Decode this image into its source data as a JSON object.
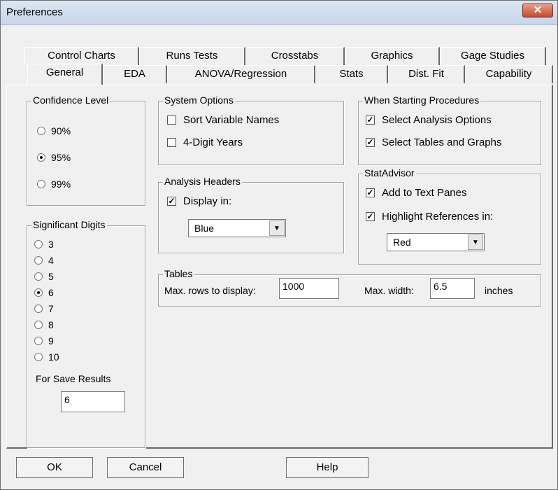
{
  "window": {
    "title": "Preferences"
  },
  "tabs_back": [
    "Control Charts",
    "Runs Tests",
    "Crosstabs",
    "Graphics",
    "Gage Studies"
  ],
  "tabs_front": [
    "General",
    "EDA",
    "ANOVA/Regression",
    "Stats",
    "Dist. Fit",
    "Capability"
  ],
  "active_tab": "General",
  "confidence": {
    "legend": "Confidence Level",
    "options": [
      "90%",
      "95%",
      "99%"
    ],
    "selected": "95%"
  },
  "digits": {
    "legend": "Significant Digits",
    "options": [
      "3",
      "4",
      "5",
      "6",
      "7",
      "8",
      "9",
      "10"
    ],
    "selected": "6",
    "save_label": "For Save Results",
    "save_value": "6"
  },
  "system": {
    "legend": "System Options",
    "sort_label": "Sort Variable Names",
    "sort_checked": false,
    "years_label": "4-Digit Years",
    "years_checked": false
  },
  "analysis_headers": {
    "legend": "Analysis Headers",
    "display_label": "Display in:",
    "display_checked": true,
    "color": "Blue"
  },
  "starting": {
    "legend": "When Starting Procedures",
    "options_label": "Select Analysis Options",
    "options_checked": true,
    "tables_label": "Select Tables and Graphs",
    "tables_checked": true
  },
  "statadvisor": {
    "legend": "StatAdvisor",
    "text_panes_label": "Add to Text Panes",
    "text_panes_checked": true,
    "highlight_label": "Highlight References in:",
    "highlight_checked": true,
    "color": "Red"
  },
  "tables": {
    "legend": "Tables",
    "rows_label": "Max. rows to display:",
    "rows_value": "1000",
    "width_label": "Max. width:",
    "width_value": "6.5",
    "units": "inches"
  },
  "buttons": {
    "ok": "OK",
    "cancel": "Cancel",
    "help": "Help"
  }
}
